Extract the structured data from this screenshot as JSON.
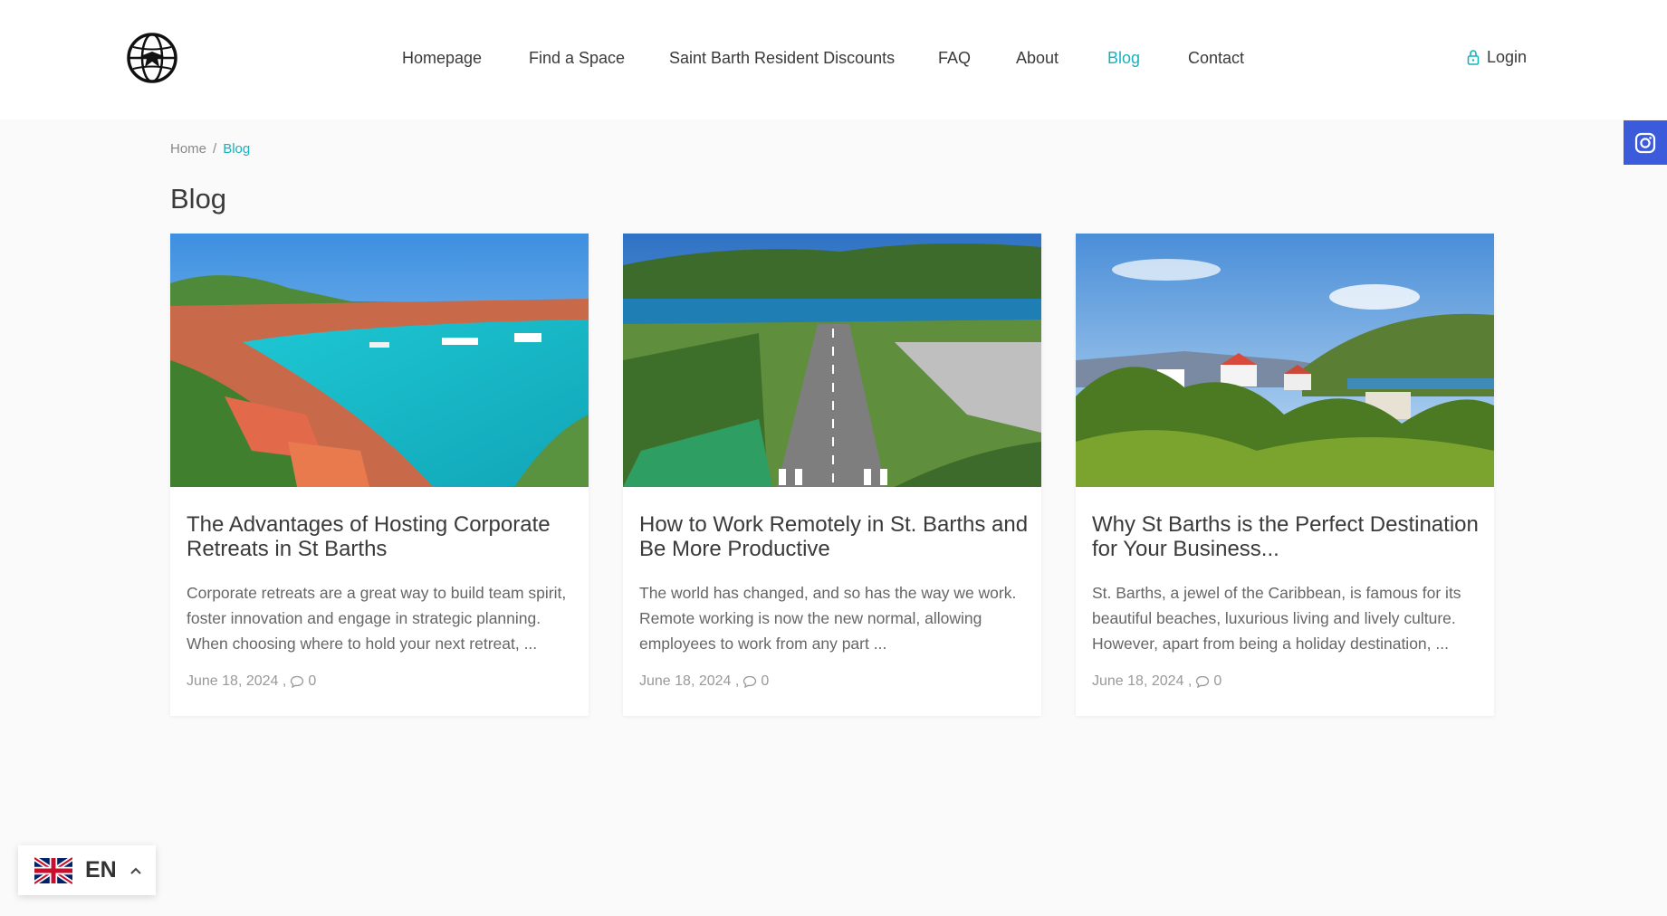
{
  "nav": {
    "items": [
      {
        "label": "Homepage",
        "active": false
      },
      {
        "label": "Find a Space",
        "active": false
      },
      {
        "label": "Saint Barth Resident Discounts",
        "active": false
      },
      {
        "label": "FAQ",
        "active": false
      },
      {
        "label": "About",
        "active": false
      },
      {
        "label": "Blog",
        "active": true
      },
      {
        "label": "Contact",
        "active": false
      }
    ],
    "login_label": "Login",
    "login_icon": "lock-icon",
    "logo_icon": "globe-plane-logo"
  },
  "social": {
    "icon": "instagram-icon",
    "color": "#3b5bdb"
  },
  "breadcrumb": {
    "home": "Home",
    "separator": "/",
    "current": "Blog"
  },
  "page_title": "Blog",
  "posts": [
    {
      "title": "The Advantages of Hosting Corporate Retreats in St Barths",
      "excerpt": "Corporate retreats are a great way to build team spirit, foster innovation and engage in strategic planning. When choosing where to hold your next retreat, ...",
      "date": "June 18, 2024 ,",
      "comments": "0",
      "image": "harbor-turquoise-bay"
    },
    {
      "title": "How to Work Remotely in St. Barths and Be More Productive",
      "excerpt": "The world has changed, and so has the way we work. Remote working is now the new normal, allowing employees to work from any part ...",
      "date": "June 18, 2024 ,",
      "comments": "0",
      "image": "airport-runway"
    },
    {
      "title": "Why St Barths is the Perfect Destination for Your Business...",
      "excerpt": "St. Barths, a jewel of the Caribbean, is famous for its beautiful beaches, luxurious living and lively culture. However, apart from being a holiday destination, ...",
      "date": "June 18, 2024 ,",
      "comments": "0",
      "image": "hillside-village"
    }
  ],
  "language": {
    "code": "EN",
    "flag": "uk-flag-icon"
  },
  "colors": {
    "accent": "#18b2bb",
    "instagram_bg": "#3b5bdb"
  }
}
